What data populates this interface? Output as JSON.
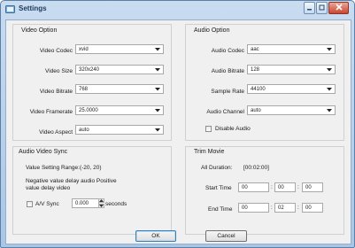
{
  "window": {
    "title": "Settings"
  },
  "video_option": {
    "title": "Video Option",
    "codec": {
      "label": "Video Codec",
      "value": "xvid"
    },
    "size": {
      "label": "Video Size",
      "value": "320x240"
    },
    "bitrate": {
      "label": "Video Bitrate",
      "value": "768"
    },
    "framerate": {
      "label": "Video Framerate",
      "value": "25.0000"
    },
    "aspect": {
      "label": "Video Aspect",
      "value": "auto"
    }
  },
  "audio_option": {
    "title": "Audio Option",
    "codec": {
      "label": "Audio Codec",
      "value": "aac"
    },
    "bitrate": {
      "label": "Audio Bitrate",
      "value": "128"
    },
    "sample_rate": {
      "label": "Sample Rate",
      "value": "44100"
    },
    "channel": {
      "label": "Audio Channel",
      "value": "auto"
    },
    "disable": {
      "label": "Disable Audio",
      "checked": false
    }
  },
  "av_sync": {
    "title": "Audio Video Sync",
    "range_text": "Value Setting Range:(-20, 20)",
    "hint_line1": "Negative value delay audio Positive",
    "hint_line2": "value delay video",
    "checkbox_label": "A/V Sync",
    "checked": false,
    "value": "0.000",
    "unit": "seconds"
  },
  "trim_movie": {
    "title": "Trim Movie",
    "all_duration_label": "All Duration:",
    "all_duration_value": "[00:02:00]",
    "start_label": "Start Time",
    "start": [
      "00",
      "00",
      "00"
    ],
    "end_label": "End Time",
    "end": [
      "00",
      "02",
      "00"
    ],
    "separator": ":"
  },
  "buttons": {
    "ok": "OK",
    "cancel": "Cancel"
  },
  "colors": {
    "title_text": "#1e395b",
    "frame": "#a9c6e6",
    "client": "#f0f0f0",
    "close": "#c9452e"
  }
}
